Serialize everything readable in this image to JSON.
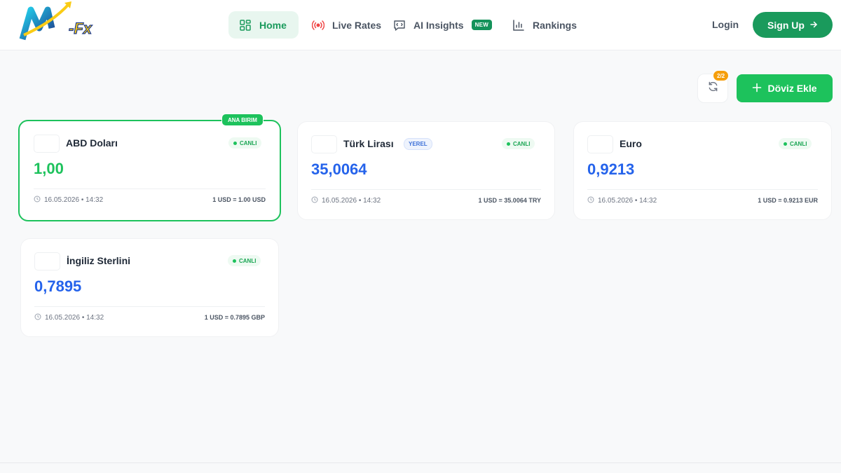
{
  "brand": {
    "logo_text": "-Fx"
  },
  "nav": {
    "home": "Home",
    "live_rates": "Live Rates",
    "ai_insights": "AI Insights",
    "ai_badge": "NEW",
    "rankings": "Rankings"
  },
  "auth": {
    "login": "Login",
    "signup": "Sign Up"
  },
  "toolbar": {
    "counter": "2/2",
    "add_label": "Döviz Ekle"
  },
  "primary_badge": "ANA BIRIM",
  "cards": [
    {
      "name": "ABD Doları",
      "status": "CANLI",
      "rate": "1,00",
      "timestamp": "16.05.2026 • 14:32",
      "conversion": "1 USD = 1.00 USD"
    },
    {
      "name": "Türk Lirası",
      "tag": "YEREL",
      "status": "CANLI",
      "rate": "35,0064",
      "timestamp": "16.05.2026 • 14:32",
      "conversion": "1 USD = 35.0064 TRY"
    },
    {
      "name": "Euro",
      "status": "CANLI",
      "rate": "0,9213",
      "timestamp": "16.05.2026 • 14:32",
      "conversion": "1 USD = 0.9213 EUR"
    },
    {
      "name": "İngiliz Sterlini",
      "status": "CANLI",
      "rate": "0,7895",
      "timestamp": "16.05.2026 • 14:32",
      "conversion": "1 USD = 0.7895 GBP"
    }
  ],
  "colors": {
    "brand_green": "#1a9a5c",
    "accent_green": "#1dc25c",
    "rate_blue": "#2563eb",
    "counter_orange": "#f59e0b"
  },
  "icons": [
    "logo-icon",
    "home-grid-icon",
    "broadcast-icon",
    "ai-chat-icon",
    "bar-chart-icon",
    "arrow-right-icon",
    "refresh-icon",
    "plus-icon",
    "clock-icon"
  ]
}
